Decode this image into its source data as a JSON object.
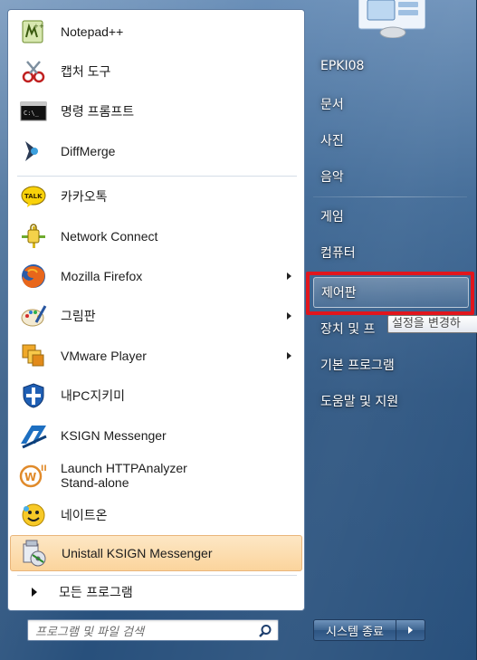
{
  "programs": [
    {
      "label": "Notepad++",
      "icon": "notepad-plus-icon",
      "arrow": false
    },
    {
      "label": "캡처 도구",
      "icon": "snipping-tool-icon",
      "arrow": false
    },
    {
      "label": "명령 프롬프트",
      "icon": "command-prompt-icon",
      "arrow": false
    },
    {
      "label": "DiffMerge",
      "icon": "diffmerge-icon",
      "arrow": false
    },
    {
      "label": "카카오톡",
      "icon": "kakaotalk-icon",
      "arrow": false
    },
    {
      "label": "Network Connect",
      "icon": "network-connect-icon",
      "arrow": false
    },
    {
      "label": "Mozilla Firefox",
      "icon": "firefox-icon",
      "arrow": true
    },
    {
      "label": "그림판",
      "icon": "paint-icon",
      "arrow": true
    },
    {
      "label": "VMware Player",
      "icon": "vmware-icon",
      "arrow": true
    },
    {
      "label": "내PC지키미",
      "icon": "shield-icon",
      "arrow": false
    },
    {
      "label": "KSIGN Messenger",
      "icon": "ksign-icon",
      "arrow": false
    },
    {
      "label": "Launch HTTPAnalyzer Stand-alone",
      "label_line1": "Launch HTTPAnalyzer",
      "label_line2": "Stand-alone",
      "icon": "httpanalyzer-icon",
      "arrow": false
    },
    {
      "label": "네이트온",
      "icon": "nateon-icon",
      "arrow": false
    },
    {
      "label": "Unistall KSIGN Messenger",
      "icon": "uninstall-icon",
      "arrow": false
    }
  ],
  "all_programs": "모든 프로그램",
  "search_placeholder": "프로그램 및 파일 검색",
  "right_items": [
    {
      "label": "EPKI08"
    },
    {
      "label": "문서"
    },
    {
      "label": "사진"
    },
    {
      "label": "음악"
    },
    {
      "label": "게임"
    },
    {
      "label": "컴퓨터"
    },
    {
      "label": "제어판"
    },
    {
      "label": "장치 및 프"
    },
    {
      "label": "기본 프로그램"
    },
    {
      "label": "도움말 및 지원"
    }
  ],
  "tooltip": "설정을 변경하",
  "shutdown_label": "시스템 종료",
  "colors": {
    "highlight_box": "#e0161d",
    "hover_item": "#fbd49c"
  }
}
